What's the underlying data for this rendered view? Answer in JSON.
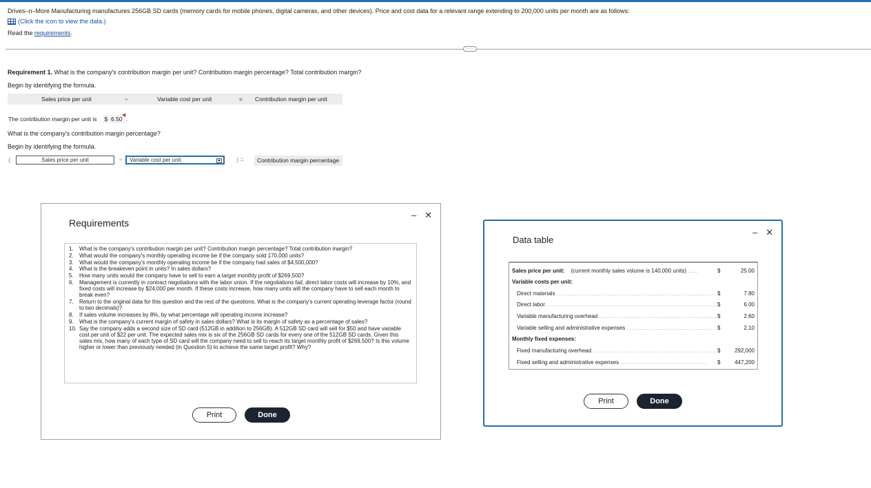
{
  "intro_text": "Drives–n–More Manufacturing manufactures 256GB SD cards (memory cards for mobile phones, digital cameras, and other devices). Price and cost data for a relevant range extending to 200,000 units per month are as follows:",
  "data_link": "(Click the icon to view the data.)",
  "read_prefix": "Read the ",
  "read_link": "requirements",
  "expand_label": "·····",
  "requirement1": {
    "label": "Requirement 1.",
    "question": " What is the company's contribution margin per unit? Contribution margin percentage? Total contribution margin?"
  },
  "begin_formula": "Begin by identifying the formula.",
  "formula1": {
    "term1": "Sales price per unit",
    "op1": "−",
    "term2": "Variable cost per unit",
    "eq": "=",
    "result": "Contribution margin per unit"
  },
  "cm_answer": {
    "label": "The contribution margin per unit is",
    "currency": "$",
    "value": "6.50",
    "suffix": "."
  },
  "q2": "What is the company's contribution margin percentage?",
  "formula2": {
    "open": "(",
    "term1": "Sales price per unit",
    "op": "÷",
    "term2": "Variable cost per unit",
    "close": ") =",
    "result": "Contribution margin percentage"
  },
  "requirements_dialog": {
    "title": "Requirements",
    "minimize": "–",
    "close": "✕",
    "items": [
      {
        "num": "1.",
        "text": "What is the company's contribution margin per unit? Contribution margin percentage? Total contribution margin?"
      },
      {
        "num": "2.",
        "text": "What would the company's monthly operating income be if the company sold 170,000 units?"
      },
      {
        "num": "3.",
        "text": "What would the company's monthly operating income be if the company had sales of $4,500,000?"
      },
      {
        "num": "4.",
        "text": "What is the breakeven point in units? In sales dollars?"
      },
      {
        "num": "5.",
        "text": "How many units would the company have to sell to earn a target monthly profit of $269,500?"
      },
      {
        "num": "6.",
        "text": "Management is currently in contract negotiations with the labor union. If the negotiations fail, direct labor costs will increase by 10%, and fixed costs will increase by $24,000 per month. If these costs increase, how many units will the company have to sell each month to break even?"
      },
      {
        "num": "7.",
        "text": "Return to the original data for this question and the rest of the questions. What is the company's current operating leverage factor (round to two decimals)?"
      },
      {
        "num": "8.",
        "text": "If sales volume increases by 8%, by what percentage will operating income increase?"
      },
      {
        "num": "9.",
        "text": "What is the company's current margin of safety in sales dollars? What is its margin of safety as a percentage of sales?"
      },
      {
        "num": "10.",
        "text": "Say the company adds a second size of SD card (512GB in addition to 256GB). A 512GB SD card will sell for $50 and have variable cost per unit of $22 per unit. The expected sales mix is six of the 256GB SD cards for every one of the 512GB SD cards. Given this sales mix, how many of each type of SD card will the company need to sell to reach its target monthly profit of $269,500? Is this volume higher or lower than previously needed (in Question 5) to achieve the same target profit? Why?"
      }
    ],
    "print_label": "Print",
    "done_label": "Done"
  },
  "data_dialog": {
    "title": "Data table",
    "minimize": "–",
    "close": "✕",
    "rows": {
      "sales_price": {
        "label": "Sales price per unit:",
        "note": "(current monthly sales volume is 140,000 units)",
        "cur": "$",
        "value": "25.00"
      },
      "variable_header": {
        "label": "Variable costs per unit:"
      },
      "direct_materials": {
        "label": "Direct materials",
        "cur": "$",
        "value": "7.80"
      },
      "direct_labor": {
        "label": "Direct labor",
        "cur": "$",
        "value": "6.00"
      },
      "var_mfg_oh": {
        "label": "Variable manufacturing overhead",
        "cur": "$",
        "value": "2.60"
      },
      "var_sga": {
        "label": "Variable selling and administrative expenses",
        "cur": "$",
        "value": "2.10"
      },
      "fixed_header": {
        "label": "Monthly fixed expenses:"
      },
      "fixed_mfg_oh": {
        "label": "Fixed manufacturing overhead",
        "cur": "$",
        "value": "292,000"
      },
      "fixed_sga": {
        "label": "Fixed selling and administrative expenses",
        "cur": "$",
        "value": "447,200"
      }
    },
    "print_label": "Print",
    "done_label": "Done"
  }
}
